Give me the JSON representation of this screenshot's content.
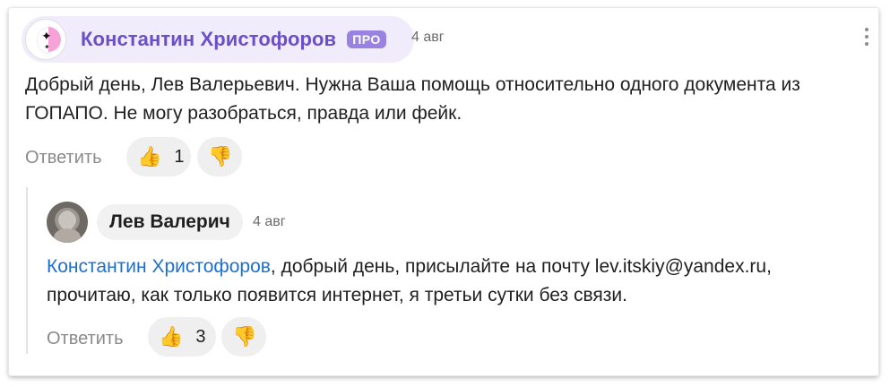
{
  "comment": {
    "author": "Константин Христофоров",
    "badge": "ПРО",
    "date": "4 авг",
    "text_line1": "Добрый день, Лев Валерьевич. Нужна Ваша помощь относительно одного документа из",
    "text_line2": "ГОПАПО. Не могу разобраться, правда или фейк.",
    "reply_label": "Ответить",
    "likes": "1"
  },
  "reply": {
    "author": "Лев Валерич",
    "date": "4 авг",
    "mention": "Константин Христофоров",
    "text_line1_rest": ", добрый день, присылайте на почту lev.itskiy@yandex.ru,",
    "text_line2": "прочитаю, как только появится интернет, я третьи сутки без связи.",
    "reply_label": "Ответить",
    "likes": "3"
  },
  "icons": {
    "like": "thumbs-up-icon",
    "dislike": "thumbs-down-icon",
    "menu": "more-vertical-icon"
  },
  "colors": {
    "author_accent": "#6a4fc9",
    "pro_badge": "#9a83e0",
    "mention": "#1b6fd1"
  }
}
